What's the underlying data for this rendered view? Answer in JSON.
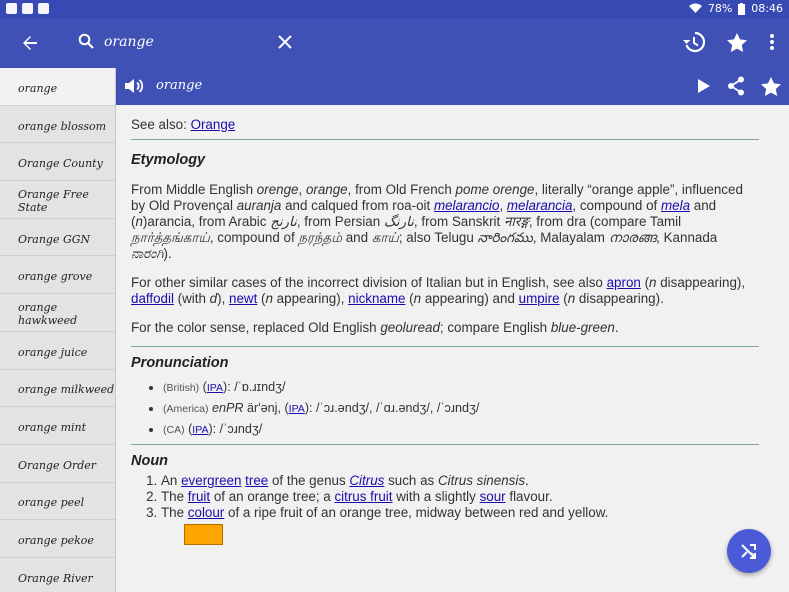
{
  "status": {
    "battery": "78%",
    "time": "08:46"
  },
  "search": {
    "query": "orange"
  },
  "sidebar": {
    "items": [
      {
        "label": "orange"
      },
      {
        "label": "orange blossom"
      },
      {
        "label": "Orange County"
      },
      {
        "label": "Orange Free State"
      },
      {
        "label": "Orange GGN"
      },
      {
        "label": "orange grove"
      },
      {
        "label": "orange hawkweed"
      },
      {
        "label": "orange juice"
      },
      {
        "label": "orange milkweed"
      },
      {
        "label": "orange mint"
      },
      {
        "label": "Orange Order"
      },
      {
        "label": "orange peel"
      },
      {
        "label": "orange pekoe"
      },
      {
        "label": "Orange River"
      }
    ]
  },
  "entry": {
    "word": "orange",
    "see_also_label": "See also: ",
    "see_also_link": "Orange",
    "etymology_heading": "Etymology",
    "etymology": {
      "p1a": "From Middle English ",
      "p1b": "orenge",
      "p1c": ", ",
      "p1d": "orange",
      "p1e": ", from Old French ",
      "p1f": "pome orenge",
      "p1g": ", literally “orange apple”, influenced by Old Provençal ",
      "p1h": "auranja",
      "p1i": " and calqued from roa-oit ",
      "link_melarancio1": "melarancio",
      "p1j": ", ",
      "link_melarancia": "melarancia",
      "p1k": ", compound of ",
      "link_mela": "mela",
      "p1l": " and (",
      "p1m": "n",
      "p1n": ")arancia, from Arabic ",
      "arabic": "نارنج",
      "p1o": ", from Persian ",
      "persian": "نارنگ",
      "p1p": ", from Sanskrit ",
      "sanskrit": "नारङ्ग",
      "p1q": ", from dra (compare Tamil ",
      "tamil1": "நார்த்தங்காய்",
      "p1r": ", compound of ",
      "tamil2": "நரந்தம்",
      "p1s": " and ",
      "tamil3": "காய்",
      "p1t": "; also Telugu ",
      "telugu": "నారింగము",
      "p1u": ", Malayalam ",
      "malayalam": "നാരങ്ങ",
      "p1v": ", Kannada ",
      "kannada": "ನಾರಂಗಿ",
      "p1w": ").",
      "p2a": "For other similar cases of the incorrect division of Italian but in English, see also ",
      "link_apron": "apron",
      "p2b": " (",
      "p2c": "n",
      "p2d": " disappearing), ",
      "link_daffodil": "daffodil",
      "p2e": " (with ",
      "p2f": "d",
      "p2g": "), ",
      "link_newt": "newt",
      "p2h": " (",
      "p2i": "n",
      "p2j": " appearing), ",
      "link_nickname": "nickname",
      "p2k": " (",
      "p2l": "n",
      "p2m": " appearing) and ",
      "link_umpire": "umpire",
      "p2n": " (",
      "p2o": "n",
      "p2p": " disappearing).",
      "p3a": "For the color sense, replaced Old English ",
      "p3b": "geoluread",
      "p3c": "; compare English ",
      "p3d": "blue-green",
      "p3e": "."
    },
    "pronunciation_heading": "Pronunciation",
    "pronunciation": [
      {
        "qual": "(British)",
        "pre": " (",
        "ipa": "IPA",
        "post": "): /ˈɒ.ɹɪndʒ/"
      },
      {
        "qual": "(America)",
        "pre": " enPR ",
        "enpr": "ärʹənj",
        "pre2": ", (",
        "ipa": "IPA",
        "post": "): /ˈɔɹ.əndʒ/, /ˈɑɹ.əndʒ/, /ˈɔɹndʒ/"
      },
      {
        "qual": "(CA)",
        "pre": " (",
        "ipa": "IPA",
        "post": "): /ˈɔɹndʒ/"
      }
    ],
    "noun_heading": "Noun",
    "senses": {
      "s1a": "An ",
      "s1_evergreen": "evergreen",
      "s1b": " ",
      "s1_tree": "tree",
      "s1c": " of the genus ",
      "s1_citrus": "Citrus",
      "s1d": " such as ",
      "s1e": "Citrus sinensis",
      "s1f": ".",
      "s2a": "The ",
      "s2_fruit": "fruit",
      "s2b": " of an orange tree; a ",
      "s2_citrusfruit": "citrus fruit",
      "s2c": " with a slightly ",
      "s2_sour": "sour",
      "s2d": " flavour.",
      "s3a": "The ",
      "s3_colour": "colour",
      "s3b": " of a ripe fruit of an orange tree, midway between red and yellow."
    },
    "swatch_color": "#ffa500"
  },
  "colors": {
    "primary": "#3f51b5",
    "status": "#3749b3",
    "fab": "#4b5bd8",
    "link": "#1a0dab"
  }
}
